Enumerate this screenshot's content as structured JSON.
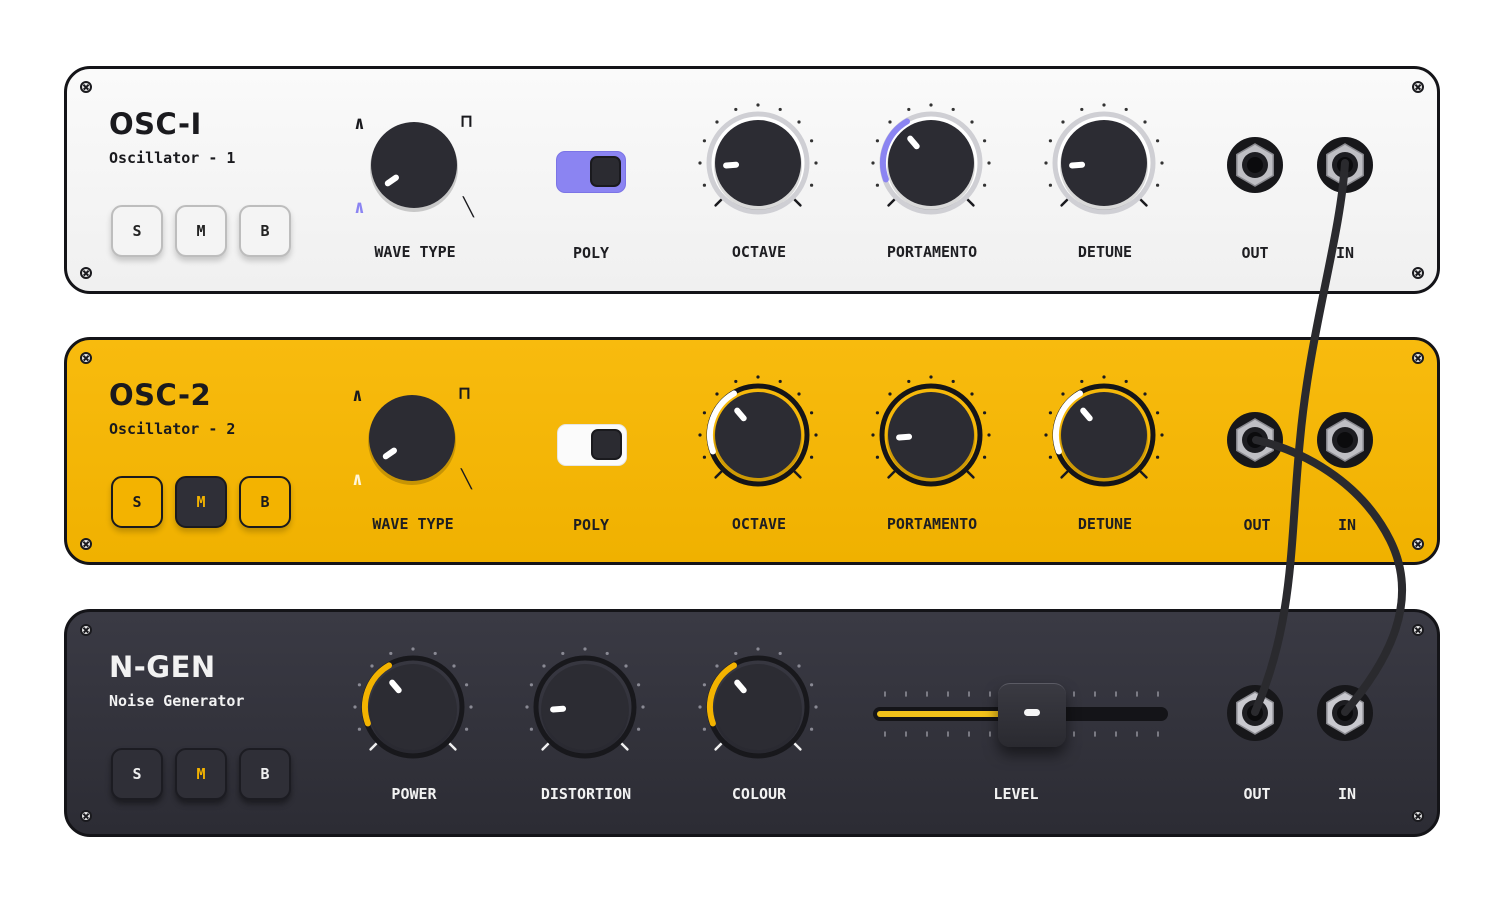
{
  "colors": {
    "accent_purple": "#8b84f2",
    "accent_yellow": "#f3b300",
    "panel_light": "#f5f5f5",
    "panel_yellow": "#f5b80a",
    "panel_dark": "#32323a",
    "knob": "#2c2c33"
  },
  "modules": [
    {
      "id": "osc1",
      "title": "OSC-I",
      "subtitle": "Oscillator - 1",
      "buttons": [
        {
          "label": "S",
          "active": false
        },
        {
          "label": "M",
          "active": false
        },
        {
          "label": "B",
          "active": false
        }
      ],
      "wave_type": {
        "label": "WAVE TYPE",
        "options": [
          "sine",
          "triangle",
          "square",
          "sawtooth"
        ],
        "selected": "sine"
      },
      "poly": {
        "label": "POLY",
        "on": true
      },
      "knobs": [
        {
          "label": "OCTAVE",
          "value": 0.15
        },
        {
          "label": "PORTAMENTO",
          "value": 0.35
        },
        {
          "label": "DETUNE",
          "value": 0.15
        }
      ],
      "jacks": [
        {
          "label": "OUT",
          "connected": false
        },
        {
          "label": "IN",
          "connected": true
        }
      ]
    },
    {
      "id": "osc2",
      "title": "OSC-2",
      "subtitle": "Oscillator - 2",
      "buttons": [
        {
          "label": "S",
          "active": false
        },
        {
          "label": "M",
          "active": true
        },
        {
          "label": "B",
          "active": false
        }
      ],
      "wave_type": {
        "label": "WAVE TYPE",
        "options": [
          "sine",
          "triangle",
          "square",
          "sawtooth"
        ],
        "selected": "sine"
      },
      "poly": {
        "label": "POLY",
        "on": false
      },
      "knobs": [
        {
          "label": "OCTAVE",
          "value": 0.35
        },
        {
          "label": "PORTAMENTO",
          "value": 0.15
        },
        {
          "label": "DETUNE",
          "value": 0.35
        }
      ],
      "jacks": [
        {
          "label": "OUT",
          "connected": true
        },
        {
          "label": "IN",
          "connected": false
        }
      ]
    },
    {
      "id": "ngen",
      "title": "N-GEN",
      "subtitle": "Noise Generator",
      "buttons": [
        {
          "label": "S",
          "active": false
        },
        {
          "label": "M",
          "active": true
        },
        {
          "label": "B",
          "active": false
        }
      ],
      "knobs": [
        {
          "label": "POWER",
          "value": 0.35
        },
        {
          "label": "DISTORTION",
          "value": 0.15
        },
        {
          "label": "COLOUR",
          "value": 0.35
        }
      ],
      "level": {
        "label": "LEVEL",
        "value": 0.6
      },
      "jacks": [
        {
          "label": "OUT",
          "connected": true
        },
        {
          "label": "IN",
          "connected": true
        }
      ]
    }
  ],
  "wave_icons": {
    "sine": "⋀",
    "triangle": "⋀",
    "square": "⊓",
    "sawtooth": "╲"
  }
}
